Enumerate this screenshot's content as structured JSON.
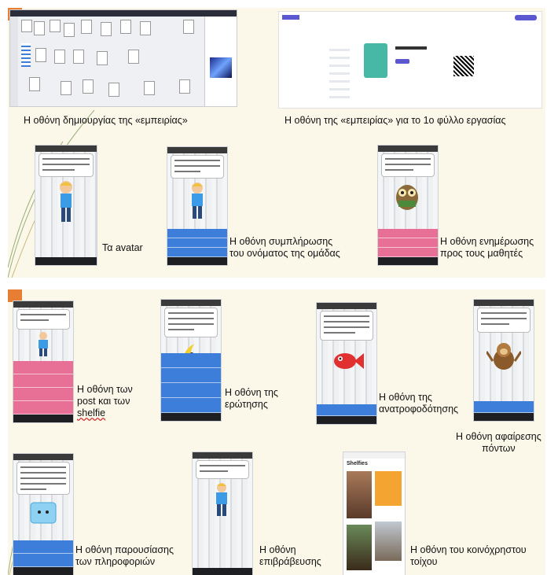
{
  "slide1": {
    "captions": {
      "editor": "Η οθόνη δημιουργίας της «εμπειρίας»",
      "experience": "Η οθόνη της «εμπειρίας» για το 1ο φύλλο εργασίας",
      "avatar": "Τα avatar",
      "team_name": [
        "Η οθόνη συμπλήρωσης",
        "του ονόματος της ομάδας"
      ],
      "update": [
        "Η οθόνη ενημέρωσης",
        "προς τους μαθητές"
      ]
    }
  },
  "slide2": {
    "captions": {
      "post": [
        "Η οθόνη των",
        "post και των"
      ],
      "post_last": "shelfie",
      "question": [
        "Η οθόνη της",
        "ερώτησης"
      ],
      "feedback": [
        "Η οθόνη της",
        "ανατροφοδότησης"
      ],
      "points": [
        "Η οθόνη αφαίρεσης",
        "πόντων"
      ],
      "info": [
        "Η οθόνη παρουσίασης",
        "των πληροφοριών"
      ],
      "reward": [
        "Η οθόνη",
        "επιβράβευσης"
      ],
      "wall": [
        "Η οθόνη του κοινόχρηστου",
        "τοίχου"
      ]
    },
    "wall_screen": {
      "title": "Shelfies"
    }
  },
  "colors": {
    "slide_bg": "#fbf8ea",
    "accent_orange": "#e87e33",
    "button_pink": "#e86f96",
    "button_blue": "#3c7ed9"
  }
}
